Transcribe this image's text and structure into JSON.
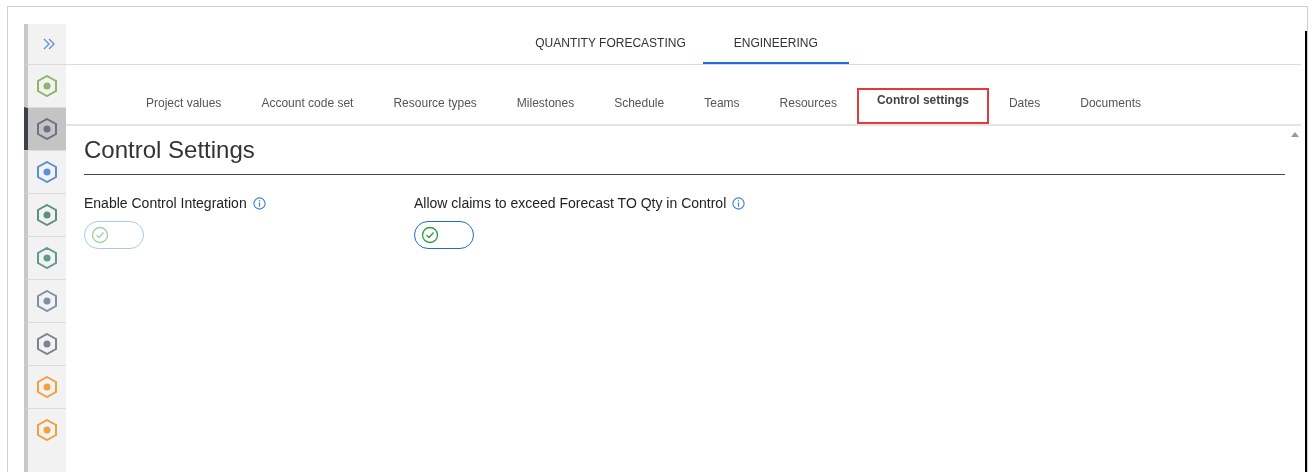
{
  "sidebar": {
    "items": [
      {
        "selected": false,
        "color": "#8fb56a"
      },
      {
        "selected": true,
        "color": "#6b7280"
      },
      {
        "selected": false,
        "color": "#5b8fd6"
      },
      {
        "selected": false,
        "color": "#5f8f7f"
      },
      {
        "selected": false,
        "color": "#5f9a8a"
      },
      {
        "selected": false,
        "color": "#7f8fa8"
      },
      {
        "selected": false,
        "color": "#7a8294"
      },
      {
        "selected": false,
        "color": "#f0a040"
      },
      {
        "selected": false,
        "color": "#f0a040"
      }
    ]
  },
  "top_tabs": [
    {
      "label": "QUANTITY FORECASTING",
      "selected": false
    },
    {
      "label": "ENGINEERING",
      "selected": true
    }
  ],
  "sub_tabs": [
    {
      "label": "Project values",
      "selected": false
    },
    {
      "label": "Account code set",
      "selected": false
    },
    {
      "label": "Resource types",
      "selected": false
    },
    {
      "label": "Milestones",
      "selected": false
    },
    {
      "label": "Schedule",
      "selected": false
    },
    {
      "label": "Teams",
      "selected": false
    },
    {
      "label": "Resources",
      "selected": false
    },
    {
      "label": "Control settings",
      "selected": true
    },
    {
      "label": "Dates",
      "selected": false
    },
    {
      "label": "Documents",
      "selected": false
    }
  ],
  "heading": "Control Settings",
  "settings": [
    {
      "label": "Enable Control Integration",
      "disabled": true
    },
    {
      "label": "Allow claims to exceed Forecast TO Qty in Control",
      "disabled": false
    }
  ]
}
